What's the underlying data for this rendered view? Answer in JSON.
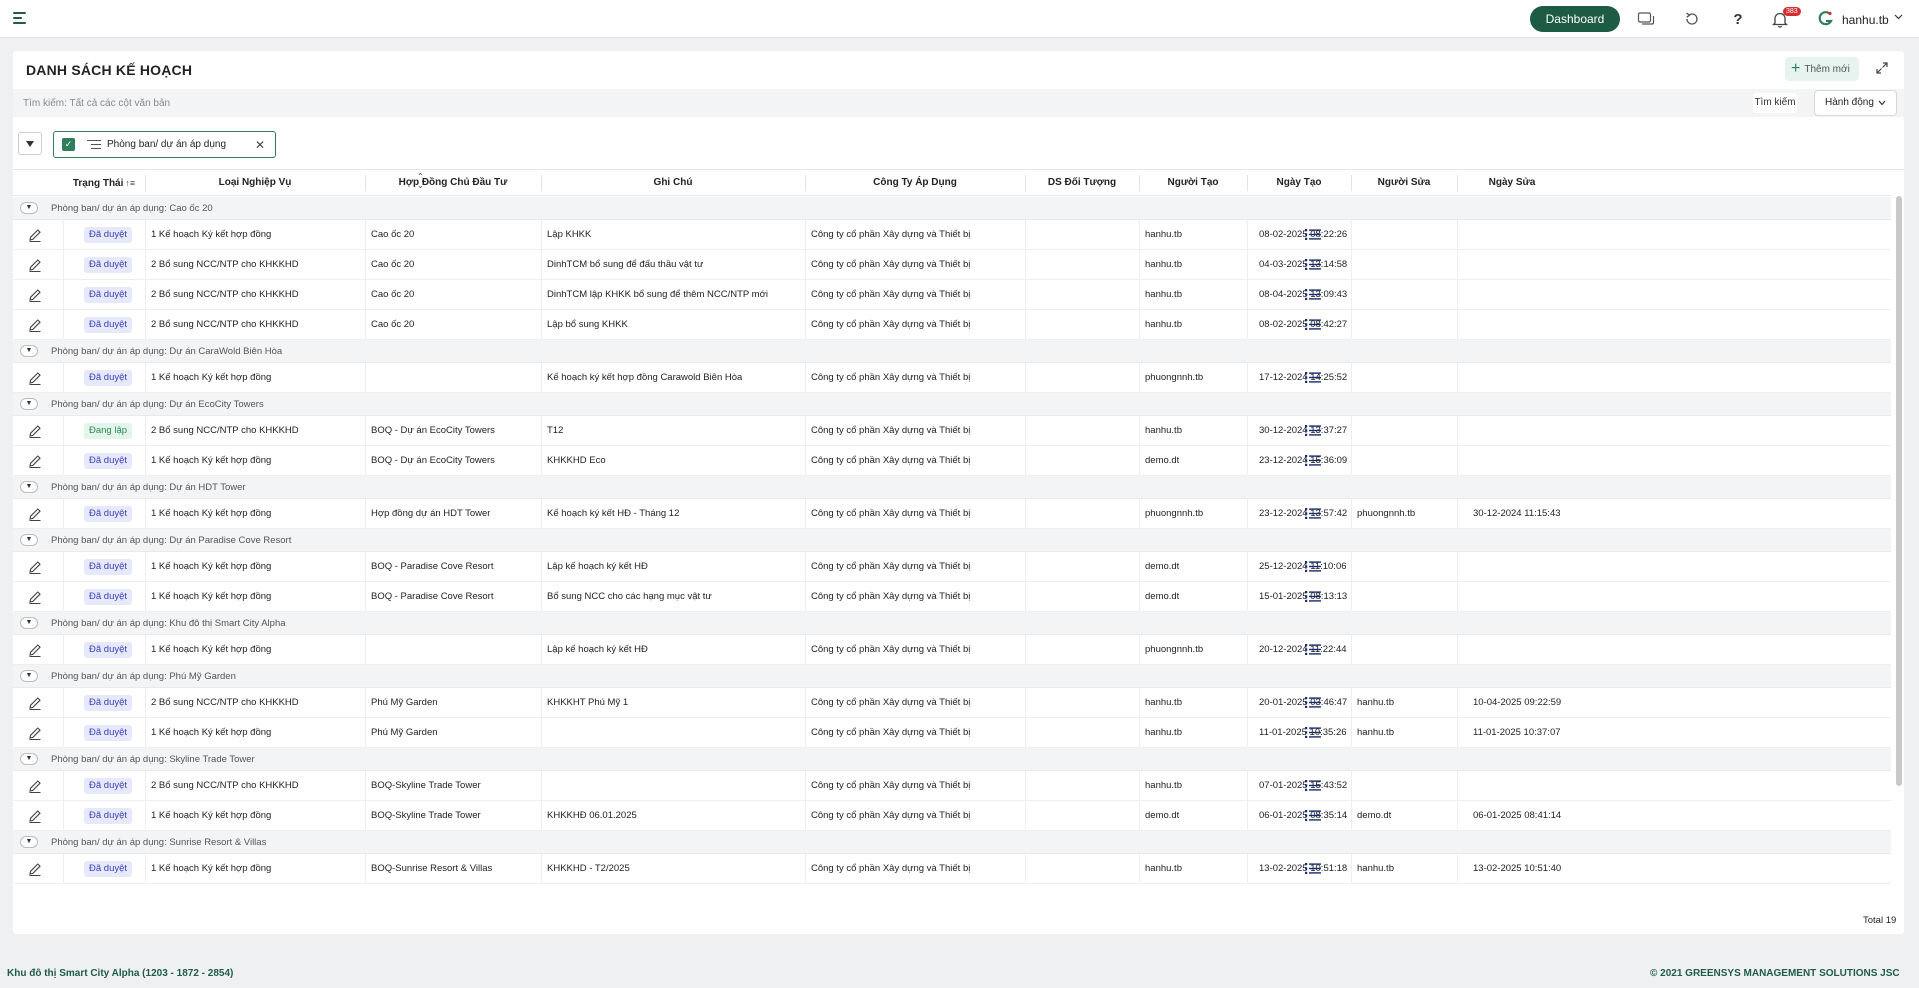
{
  "header": {
    "dashboard_label": "Dashboard",
    "notification_count": "383",
    "username": "hanhu.tb",
    "brand_color": "#1e5b45"
  },
  "page": {
    "title": "DANH SÁCH KẾ HOẠCH",
    "add_label": "Thêm mới",
    "search_placeholder": "Tìm kiếm: Tất cả các cột văn bản",
    "search_button": "Tìm kiếm",
    "action_button": "Hành động",
    "group_chip_label": "Phòng ban/ dự án áp dụng",
    "total": "Total 19"
  },
  "table": {
    "columns": [
      "Trạng Thái",
      "Loại Nghiệp Vụ",
      "Hợp Đồng Chủ Đầu Tư",
      "Ghi Chú",
      "Công Ty Áp Dụng",
      "DS Đối Tượng",
      "Người Tạo",
      "Ngày Tạo",
      "Người Sửa",
      "Ngày Sửa"
    ],
    "groups": [
      {
        "label": "Phòng ban/ dự án áp dụng: Cao ốc 20",
        "rows": [
          {
            "status": "Đã duyệt",
            "type": "1 Kế hoạch Ký kết hợp đồng",
            "contract": "Cao ốc 20",
            "note": "Lập KHKK",
            "company": "Công ty cổ phần Xây dựng và Thiết bị",
            "creator": "hanhu.tb",
            "created": "08-02-2025 08:22:26",
            "editor": "",
            "edited": ""
          },
          {
            "status": "Đã duyệt",
            "type": "2 Bổ sung NCC/NTP cho KHKKHD",
            "contract": "Cao ốc 20",
            "note": "DinhTCM bổ sung để đấu thầu vật tư",
            "company": "Công ty cổ phần Xây dựng và Thiết bị",
            "creator": "hanhu.tb",
            "created": "04-03-2025 13:14:58",
            "editor": "",
            "edited": ""
          },
          {
            "status": "Đã duyệt",
            "type": "2 Bổ sung NCC/NTP cho KHKKHD",
            "contract": "Cao ốc 20",
            "note": "DinhTCM lập KHKK bổ sung để thêm NCC/NTP mới",
            "company": "Công ty cổ phần Xây dựng và Thiết bị",
            "creator": "hanhu.tb",
            "created": "08-04-2025 13:09:43",
            "editor": "",
            "edited": ""
          },
          {
            "status": "Đã duyệt",
            "type": "2 Bổ sung NCC/NTP cho KHKKHD",
            "contract": "Cao ốc 20",
            "note": "Lập bổ sung KHKK",
            "company": "Công ty cổ phần Xây dựng và Thiết bị",
            "creator": "hanhu.tb",
            "created": "08-02-2025 08:42:27",
            "editor": "",
            "edited": ""
          }
        ]
      },
      {
        "label": "Phòng ban/ dự án áp dụng: Dự án CaraWold Biên Hòa",
        "rows": [
          {
            "status": "Đã duyệt",
            "type": "1 Kế hoạch Ký kết hợp đồng",
            "contract": "",
            "note": "Kế hoạch ký kết hợp đồng Carawold Biên Hòa",
            "company": "Công ty cổ phần Xây dựng và Thiết bị",
            "creator": "phuongnnh.tb",
            "created": "17-12-2024 14:25:52",
            "editor": "",
            "edited": ""
          }
        ]
      },
      {
        "label": "Phòng ban/ dự án áp dụng: Dự án EcoCity Towers",
        "rows": [
          {
            "status": "Đang lập",
            "type": "2 Bổ sung NCC/NTP cho KHKKHD",
            "contract": "BOQ - Dự án EcoCity Towers",
            "note": "T12",
            "company": "Công ty cổ phần Xây dựng và Thiết bị",
            "creator": "hanhu.tb",
            "created": "30-12-2024 13:37:27",
            "editor": "",
            "edited": ""
          },
          {
            "status": "Đã duyệt",
            "type": "1 Kế hoạch Ký kết hợp đồng",
            "contract": "BOQ - Dự án EcoCity Towers",
            "note": "KHKKHD Eco",
            "company": "Công ty cổ phần Xây dựng và Thiết bị",
            "creator": "demo.dt",
            "created": "23-12-2024 15:36:09",
            "editor": "",
            "edited": ""
          }
        ]
      },
      {
        "label": "Phòng ban/ dự án áp dụng: Dự án HDT Tower",
        "rows": [
          {
            "status": "Đã duyệt",
            "type": "1 Kế hoạch Ký kết hợp đồng",
            "contract": "Hợp đồng dự án HDT Tower",
            "note": "Kế hoạch ký kết HĐ - Tháng 12",
            "company": "Công ty cổ phần Xây dựng và Thiết bị",
            "creator": "phuongnnh.tb",
            "created": "23-12-2024 13:57:42",
            "editor": "phuongnnh.tb",
            "edited": "30-12-2024 11:15:43"
          }
        ]
      },
      {
        "label": "Phòng ban/ dự án áp dụng: Dự án Paradise Cove Resort",
        "rows": [
          {
            "status": "Đã duyệt",
            "type": "1 Kế hoạch Ký kết hợp đồng",
            "contract": "BOQ - Paradise Cove Resort",
            "note": "Lập kế hoạch ký kết HĐ",
            "company": "Công ty cổ phần Xây dựng và Thiết bị",
            "creator": "demo.dt",
            "created": "25-12-2024 11:10:06",
            "editor": "",
            "edited": ""
          },
          {
            "status": "Đã duyệt",
            "type": "1 Kế hoạch Ký kết hợp đồng",
            "contract": "BOQ - Paradise Cove Resort",
            "note": "Bổ sung NCC cho các hạng mục vật tư",
            "company": "Công ty cổ phần Xây dựng và Thiết bị",
            "creator": "demo.dt",
            "created": "15-01-2025 08:13:13",
            "editor": "",
            "edited": ""
          }
        ]
      },
      {
        "label": "Phòng ban/ dự án áp dụng: Khu đô thị Smart City Alpha",
        "rows": [
          {
            "status": "Đã duyệt",
            "type": "1 Kế hoạch Ký kết hợp đồng",
            "contract": "",
            "note": "Lập kế hoạch ký kết HĐ",
            "company": "Công ty cổ phần Xây dựng và Thiết bị",
            "creator": "phuongnnh.tb",
            "created": "20-12-2024 11:22:44",
            "editor": "",
            "edited": ""
          }
        ]
      },
      {
        "label": "Phòng ban/ dự án áp dụng: Phú Mỹ Garden",
        "rows": [
          {
            "status": "Đã duyệt",
            "type": "2 Bổ sung NCC/NTP cho KHKKHD",
            "contract": "Phú Mỹ Garden",
            "note": "KHKKHT Phú Mỹ 1",
            "company": "Công ty cổ phần Xây dựng và Thiết bị",
            "creator": "hanhu.tb",
            "created": "20-01-2025 03:46:47",
            "editor": "hanhu.tb",
            "edited": "10-04-2025 09:22:59"
          },
          {
            "status": "Đã duyệt",
            "type": "1 Kế hoạch Ký kết hợp đồng",
            "contract": "Phú Mỹ Garden",
            "note": "",
            "company": "Công ty cổ phần Xây dựng và Thiết bị",
            "creator": "hanhu.tb",
            "created": "11-01-2025 10:35:26",
            "editor": "hanhu.tb",
            "edited": "11-01-2025 10:37:07"
          }
        ]
      },
      {
        "label": "Phòng ban/ dự án áp dụng: Skyline Trade Tower",
        "rows": [
          {
            "status": "Đã duyệt",
            "type": "2 Bổ sung NCC/NTP cho KHKKHD",
            "contract": "BOQ-Skyline Trade Tower",
            "note": "",
            "company": "Công ty cổ phần Xây dựng và Thiết bị",
            "creator": "hanhu.tb",
            "created": "07-01-2025 15:43:52",
            "editor": "",
            "edited": ""
          },
          {
            "status": "Đã duyệt",
            "type": "1 Kế hoạch Ký kết hợp đồng",
            "contract": "BOQ-Skyline Trade Tower",
            "note": "KHKKHĐ 06.01.2025",
            "company": "Công ty cổ phần Xây dựng và Thiết bị",
            "creator": "demo.dt",
            "created": "06-01-2025 08:35:14",
            "editor": "demo.dt",
            "edited": "06-01-2025 08:41:14"
          }
        ]
      },
      {
        "label": "Phòng ban/ dự án áp dụng: Sunrise Resort & Villas",
        "rows": [
          {
            "status": "Đã duyệt",
            "type": "1 Kế hoạch Ký kết hợp đồng",
            "contract": "BOQ-Sunrise Resort & Villas",
            "note": "KHKKHD - T2/2025",
            "company": "Công ty cổ phần Xây dựng và Thiết bị",
            "creator": "hanhu.tb",
            "created": "13-02-2025 10:51:18",
            "editor": "hanhu.tb",
            "edited": "13-02-2025 10:51:40"
          }
        ]
      }
    ]
  },
  "status_colors": {
    "Đã duyệt": {
      "bg": "#e6e8fb",
      "fg": "#3d3fb8"
    },
    "Đang lập": {
      "bg": "#e3f4ea",
      "fg": "#2e8b57"
    }
  },
  "footer": {
    "project": "Khu đô thị Smart City Alpha (1203 - 1872 - 2854)",
    "copyright": "© 2021 GREENSYS MANAGEMENT SOLUTIONS JSC"
  }
}
